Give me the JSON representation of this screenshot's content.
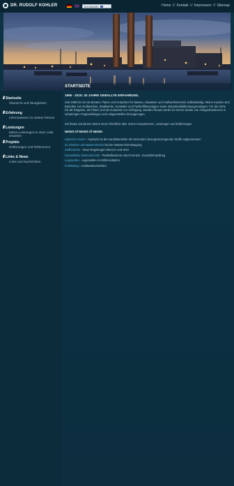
{
  "header": {
    "logo_text": "DR. RUDOLF KOHLER",
    "share_label": "BOOKMARK",
    "nav": [
      "Home",
      "Kontakt",
      "Impressum",
      "Sitemap"
    ],
    "nav_separator": "///"
  },
  "sidebar": {
    "items": [
      {
        "title": "Startseite",
        "subtitle": "Übersicht und Neuigkeiten"
      },
      {
        "title": "Erfahrung",
        "subtitle": "Informationen zu meiner Person"
      },
      {
        "title": "Leistungen",
        "subtitle": "Meine Leistungen in einer Liste erwarten"
      },
      {
        "title": "Projekte",
        "subtitle": "Erfahrungen und Referenzen"
      },
      {
        "title": "Links & News",
        "subtitle": "Links und Nachrichten"
      }
    ]
  },
  "main": {
    "page_title": "STARTSEITE",
    "intro_heading": "1995 - 2015: 20 JAHRE GEBALLTE ERFAHRUNG.",
    "intro_text": "Seit 1995 bin ich als Berater, Planer und Gutachter für Wasser, Abwasser und Kraftwerkschemie selbstständig. Meine Kunden sind Betreiber von Kraftwerken, Stadtwerke, Hersteller und Partikelfilteranlagen sowie Industrieabfallentsorgeranlagen. Für die ziehe ich als Ratgeber, als Planer und als Gutachter zur Verfügung. Darüber hinaus werde ich immer wieder von Anlagenbauherren in schwierigen Fragestellungen und Anlagenstellen hinzugezogen.",
    "intro_text2": "Sie finden auf diesen Seiten einen Überblick über meine Kompetenzen, Leistungen und Erfahrungen.",
    "news_heading": "NEWS /// NEWS /// NEWS",
    "news": [
      {
        "link": "Hydrazin ersetzt",
        "text": " - Hydrazin ist die Kandidatenliste der besonders besorgniserregender Stoffe aufgenommen"
      },
      {
        "link": "Zu Struktur und Wasserchemie",
        "text": " bei der Wasserchemietagung"
      },
      {
        "link": "Stoffverbote",
        "text": " - Neue Regelungen REACH und GHS"
      },
      {
        "link": "Keramikfolie Wärmetechnik",
        "text": " - Partikelbarrieren durch kerami. Zusatzbehandlung"
      },
      {
        "link": "Legionellen",
        "text": " - Legionellen in Kühlkreisläufen"
      },
      {
        "link": "Fortbildung",
        "text": " - Kraftwerkschemiker"
      }
    ]
  },
  "colors": {
    "background": "#0b2a3a",
    "link": "#5fb4d9",
    "text": "#b9d0db"
  }
}
